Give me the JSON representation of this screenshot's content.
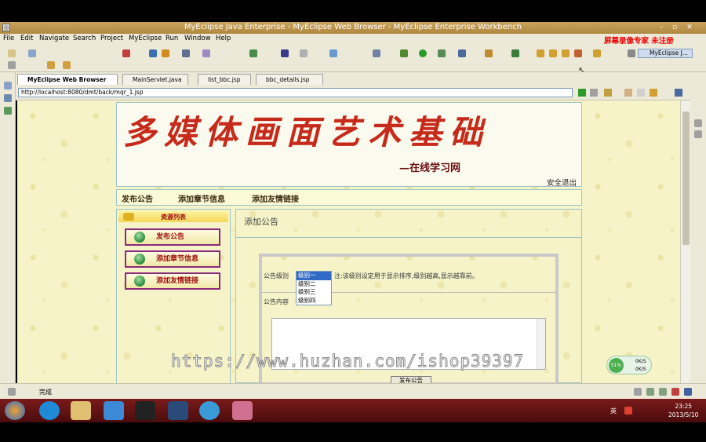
{
  "window": {
    "title": "MyEclipse Java Enterprise - MyEclipse Web Browser - MyEclipse Enterprise Workbench",
    "overlay_note": "屏幕录像专家 未注册"
  },
  "menu": [
    "File",
    "Edit",
    "Navigate",
    "Search",
    "Project",
    "MyEclipse",
    "Run",
    "Window",
    "Help"
  ],
  "perspective": "MyEclipse J...",
  "tabs": [
    {
      "label": "MyEclipse Web Browser",
      "active": true
    },
    {
      "label": "MainServlet.java",
      "active": false
    },
    {
      "label": "list_bbc.jsp",
      "active": false
    },
    {
      "label": "bbc_details.jsp",
      "active": false
    }
  ],
  "address": {
    "url": "http://localhost:8080/dmt/back/mqr_1.jsp"
  },
  "page": {
    "banner_title": "多媒体画面艺术基础",
    "banner_subtitle": "—在线学习网",
    "logout": "安全退出",
    "nav": [
      "发布公告",
      "添加章节信息",
      "添加友情链接"
    ],
    "sidebar_head": "资源列表",
    "sidebar_items": [
      "发布公告",
      "添加章节信息",
      "添加友情链接"
    ],
    "panel_title": "添加公告",
    "form": {
      "level_label": "公告级别",
      "level_hint": "注:该级别设定用于显示排序,级别越高,显示越靠前。",
      "level_options": [
        "级别一",
        "级别二",
        "级别三",
        "级别四"
      ],
      "content_label": "公告内容",
      "submit_label": "发布公告"
    }
  },
  "watermark": "https://www.huzhan.com/ishop39397",
  "net_widget": {
    "percent": "51%",
    "up": "0K/S",
    "down": "0K/S"
  },
  "status": {
    "text": "完成"
  },
  "clock": {
    "time": "23:25",
    "date": "2013/5/10"
  },
  "tray_lang": "英",
  "colors": {
    "title_red": "#c62a1a",
    "panel_border": "#9ec5c5",
    "taskbar": "#5a1010"
  }
}
